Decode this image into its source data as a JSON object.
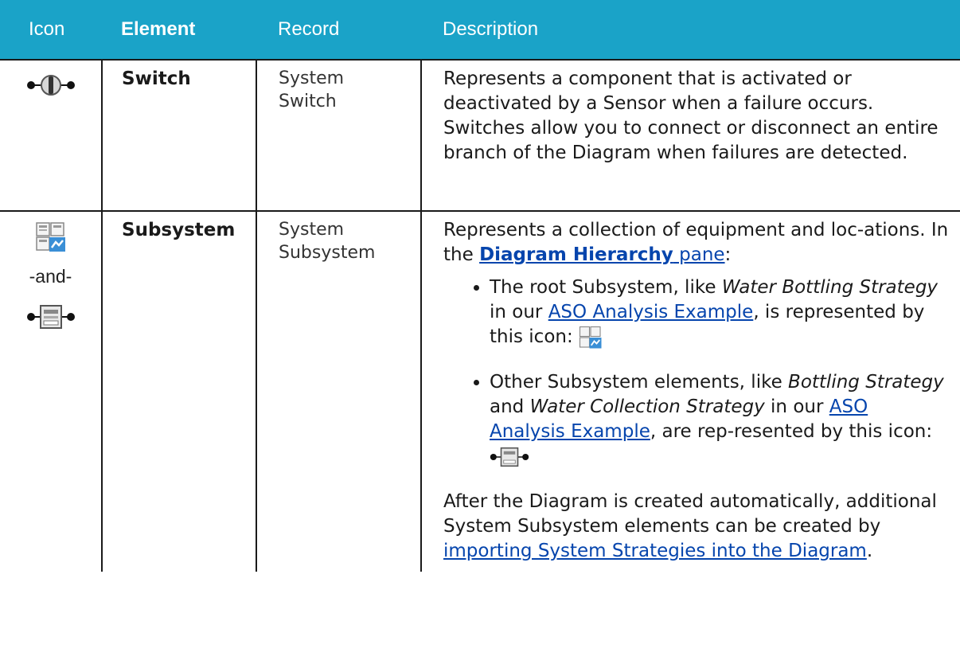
{
  "header": {
    "icon": "Icon",
    "element": "Element",
    "record": "Record",
    "description": "Description"
  },
  "rows": [
    {
      "icon": "switch-node-icon",
      "element": "Switch",
      "record_line1": "System",
      "record_line2": "Switch",
      "description": "Represents a component that is activated or deactivated by a Sensor when a failure occurs. Switches allow you to connect or disconnect an entire branch of the Diagram when failures are detected."
    },
    {
      "icon_root": "root-subsystem-icon",
      "and_text": "-and-",
      "icon_node": "subsystem-node-icon",
      "element": "Subsystem",
      "record_line1": "System",
      "record_line2": "Subsystem",
      "intro_a": "Represents a collection of equipment and loc-ations. In the ",
      "intro_link_bold": "Diagram Hierarchy",
      "intro_link_pane": " pane",
      "intro_b": ":",
      "bullet1_a": "The root Subsystem, like ",
      "bullet1_italic": "Water Bottling Strategy",
      "bullet1_b": " in our ",
      "bullet1_link": "ASO Analysis Example",
      "bullet1_c": ", is represented by this icon: ",
      "bullet2_a": "Other Subsystem elements, like ",
      "bullet2_italic1": "Bottling Strategy",
      "bullet2_b": " and ",
      "bullet2_italic2": "Water Collection Strategy",
      "bullet2_c": " in our ",
      "bullet2_link": "ASO Analysis Example",
      "bullet2_d": ", are rep-resented by this icon: ",
      "outro_a": "After the Diagram is created automatically, additional System Subsystem elements can be created by ",
      "outro_link": "importing System Strategies into the Diagram",
      "outro_b": "."
    }
  ],
  "colors": {
    "header_bg": "#1aa3c8",
    "link": "#0645ad",
    "root_icon_accent": "#3a8fd6"
  }
}
